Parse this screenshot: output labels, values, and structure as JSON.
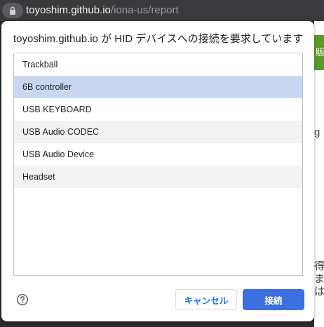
{
  "address_bar": {
    "host": "toyoshim.github.io",
    "path": "/iona-us/report",
    "icon": "lock-icon"
  },
  "background_page": {
    "green_label": "販",
    "fragments": [
      "g",
      "得",
      "ます",
      "は"
    ]
  },
  "dialog": {
    "title": "toyoshim.github.io が HID デバイスへの接続を要求しています",
    "devices": [
      {
        "label": "Trackball",
        "selected": false
      },
      {
        "label": "6B controller",
        "selected": true
      },
      {
        "label": "USB KEYBOARD",
        "selected": false
      },
      {
        "label": "USB Audio CODEC",
        "selected": false
      },
      {
        "label": "USB Audio Device",
        "selected": false
      },
      {
        "label": "Headset",
        "selected": false
      }
    ],
    "help_icon": "help-circle-icon",
    "cancel_label": "キャンセル",
    "connect_label": "接続"
  },
  "colors": {
    "selected_row": "#c9d7f3",
    "primary_button": "#3c6fe0",
    "address_bar": "#3a3a3c"
  }
}
